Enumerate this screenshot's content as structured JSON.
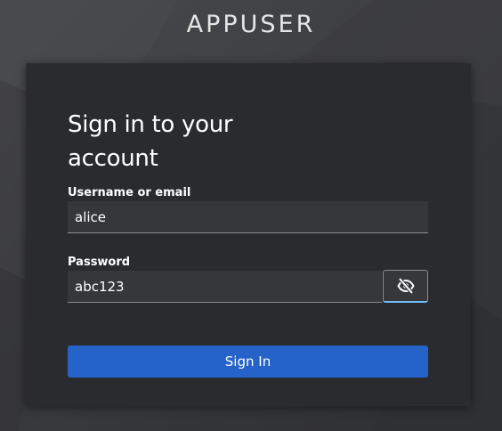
{
  "brand": {
    "name": "APPUSER"
  },
  "login": {
    "title": "Sign in to your account",
    "username_label": "Username or email",
    "username_value": "alice",
    "password_label": "Password",
    "password_value": "abc123",
    "toggle_icon": "eye-slash-icon",
    "submit_label": "Sign In"
  },
  "colors": {
    "card": "#292b2f",
    "input": "#36373b",
    "primary_button": "#2563c9",
    "focus_accent": "#73bcf7"
  }
}
